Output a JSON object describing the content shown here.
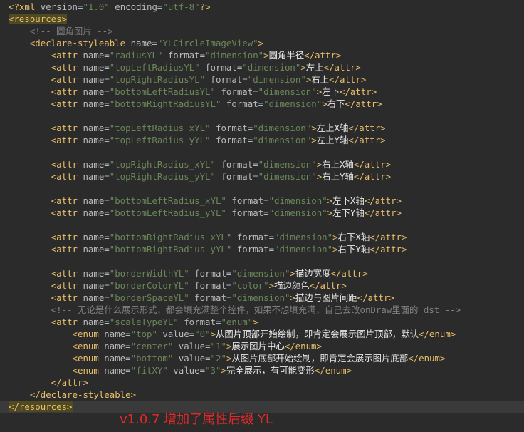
{
  "editor": {
    "lines": [
      {
        "indent": "",
        "tokens": [
          [
            "prolog",
            "<?xml "
          ],
          [
            "attr",
            "version"
          ],
          [
            "plain",
            "="
          ],
          [
            "val",
            "\"1.0\""
          ],
          [
            "plain",
            " "
          ],
          [
            "attr",
            "encoding"
          ],
          [
            "plain",
            "="
          ],
          [
            "val",
            "\"utf-8\""
          ],
          [
            "prolog",
            "?>"
          ]
        ]
      },
      {
        "indent": "",
        "mark": true,
        "tokens": [
          [
            "tag",
            "<resources>"
          ]
        ]
      },
      {
        "indent": "    ",
        "tokens": [
          [
            "comment",
            "<!-- 圆角图片 -->"
          ]
        ]
      },
      {
        "indent": "    ",
        "tokens": [
          [
            "tag",
            "<declare-styleable "
          ],
          [
            "attr",
            "name"
          ],
          [
            "plain",
            "="
          ],
          [
            "val",
            "\"YLCircleImageView\""
          ],
          [
            "tag",
            ">"
          ]
        ]
      },
      {
        "indent": "        ",
        "tokens": [
          [
            "tag",
            "<attr "
          ],
          [
            "attr",
            "name"
          ],
          [
            "plain",
            "="
          ],
          [
            "val",
            "\"radiusYL\""
          ],
          [
            "plain",
            " "
          ],
          [
            "attr",
            "format"
          ],
          [
            "plain",
            "="
          ],
          [
            "val",
            "\"dimension\""
          ],
          [
            "tag",
            ">"
          ],
          [
            "text",
            "圆角半径"
          ],
          [
            "tag",
            "</attr>"
          ]
        ]
      },
      {
        "indent": "        ",
        "tokens": [
          [
            "tag",
            "<attr "
          ],
          [
            "attr",
            "name"
          ],
          [
            "plain",
            "="
          ],
          [
            "val",
            "\"topLeftRadiusYL\""
          ],
          [
            "plain",
            " "
          ],
          [
            "attr",
            "format"
          ],
          [
            "plain",
            "="
          ],
          [
            "val",
            "\"dimension\""
          ],
          [
            "tag",
            ">"
          ],
          [
            "text",
            "左上"
          ],
          [
            "tag",
            "</attr>"
          ]
        ]
      },
      {
        "indent": "        ",
        "tokens": [
          [
            "tag",
            "<attr "
          ],
          [
            "attr",
            "name"
          ],
          [
            "plain",
            "="
          ],
          [
            "val",
            "\"topRightRadiusYL\""
          ],
          [
            "plain",
            " "
          ],
          [
            "attr",
            "format"
          ],
          [
            "plain",
            "="
          ],
          [
            "val",
            "\"dimension\""
          ],
          [
            "tag",
            ">"
          ],
          [
            "text",
            "右上"
          ],
          [
            "tag",
            "</attr>"
          ]
        ]
      },
      {
        "indent": "        ",
        "tokens": [
          [
            "tag",
            "<attr "
          ],
          [
            "attr",
            "name"
          ],
          [
            "plain",
            "="
          ],
          [
            "val",
            "\"bottomLeftRadiusYL\""
          ],
          [
            "plain",
            " "
          ],
          [
            "attr",
            "format"
          ],
          [
            "plain",
            "="
          ],
          [
            "val",
            "\"dimension\""
          ],
          [
            "tag",
            ">"
          ],
          [
            "text",
            "左下"
          ],
          [
            "tag",
            "</attr>"
          ]
        ]
      },
      {
        "indent": "        ",
        "tokens": [
          [
            "tag",
            "<attr "
          ],
          [
            "attr",
            "name"
          ],
          [
            "plain",
            "="
          ],
          [
            "val",
            "\"bottomRightRadiusYL\""
          ],
          [
            "plain",
            " "
          ],
          [
            "attr",
            "format"
          ],
          [
            "plain",
            "="
          ],
          [
            "val",
            "\"dimension\""
          ],
          [
            "tag",
            ">"
          ],
          [
            "text",
            "右下"
          ],
          [
            "tag",
            "</attr>"
          ]
        ]
      },
      {
        "indent": "",
        "tokens": []
      },
      {
        "indent": "        ",
        "tokens": [
          [
            "tag",
            "<attr "
          ],
          [
            "attr",
            "name"
          ],
          [
            "plain",
            "="
          ],
          [
            "val",
            "\"topLeftRadius_xYL\""
          ],
          [
            "plain",
            " "
          ],
          [
            "attr",
            "format"
          ],
          [
            "plain",
            "="
          ],
          [
            "val",
            "\"dimension\""
          ],
          [
            "tag",
            ">"
          ],
          [
            "text",
            "左上X轴"
          ],
          [
            "tag",
            "</attr>"
          ]
        ]
      },
      {
        "indent": "        ",
        "tokens": [
          [
            "tag",
            "<attr "
          ],
          [
            "attr",
            "name"
          ],
          [
            "plain",
            "="
          ],
          [
            "val",
            "\"topLeftRadius_yYL\""
          ],
          [
            "plain",
            " "
          ],
          [
            "attr",
            "format"
          ],
          [
            "plain",
            "="
          ],
          [
            "val",
            "\"dimension\""
          ],
          [
            "tag",
            ">"
          ],
          [
            "text",
            "左上Y轴"
          ],
          [
            "tag",
            "</attr>"
          ]
        ]
      },
      {
        "indent": "",
        "tokens": []
      },
      {
        "indent": "        ",
        "tokens": [
          [
            "tag",
            "<attr "
          ],
          [
            "attr",
            "name"
          ],
          [
            "plain",
            "="
          ],
          [
            "val",
            "\"topRightRadius_xYL\""
          ],
          [
            "plain",
            " "
          ],
          [
            "attr",
            "format"
          ],
          [
            "plain",
            "="
          ],
          [
            "val",
            "\"dimension\""
          ],
          [
            "tag",
            ">"
          ],
          [
            "text",
            "右上X轴"
          ],
          [
            "tag",
            "</attr>"
          ]
        ]
      },
      {
        "indent": "        ",
        "tokens": [
          [
            "tag",
            "<attr "
          ],
          [
            "attr",
            "name"
          ],
          [
            "plain",
            "="
          ],
          [
            "val",
            "\"topRightRadius_yYL\""
          ],
          [
            "plain",
            " "
          ],
          [
            "attr",
            "format"
          ],
          [
            "plain",
            "="
          ],
          [
            "val",
            "\"dimension\""
          ],
          [
            "tag",
            ">"
          ],
          [
            "text",
            "右上Y轴"
          ],
          [
            "tag",
            "</attr>"
          ]
        ]
      },
      {
        "indent": "",
        "tokens": []
      },
      {
        "indent": "        ",
        "tokens": [
          [
            "tag",
            "<attr "
          ],
          [
            "attr",
            "name"
          ],
          [
            "plain",
            "="
          ],
          [
            "val",
            "\"bottomLeftRadius_xYL\""
          ],
          [
            "plain",
            " "
          ],
          [
            "attr",
            "format"
          ],
          [
            "plain",
            "="
          ],
          [
            "val",
            "\"dimension\""
          ],
          [
            "tag",
            ">"
          ],
          [
            "text",
            "左下X轴"
          ],
          [
            "tag",
            "</attr>"
          ]
        ]
      },
      {
        "indent": "        ",
        "tokens": [
          [
            "tag",
            "<attr "
          ],
          [
            "attr",
            "name"
          ],
          [
            "plain",
            "="
          ],
          [
            "val",
            "\"bottomLeftRadius_yYL\""
          ],
          [
            "plain",
            " "
          ],
          [
            "attr",
            "format"
          ],
          [
            "plain",
            "="
          ],
          [
            "val",
            "\"dimension\""
          ],
          [
            "tag",
            ">"
          ],
          [
            "text",
            "左下Y轴"
          ],
          [
            "tag",
            "</attr>"
          ]
        ]
      },
      {
        "indent": "",
        "tokens": []
      },
      {
        "indent": "        ",
        "tokens": [
          [
            "tag",
            "<attr "
          ],
          [
            "attr",
            "name"
          ],
          [
            "plain",
            "="
          ],
          [
            "val",
            "\"bottomRightRadius_xYL\""
          ],
          [
            "plain",
            " "
          ],
          [
            "attr",
            "format"
          ],
          [
            "plain",
            "="
          ],
          [
            "val",
            "\"dimension\""
          ],
          [
            "tag",
            ">"
          ],
          [
            "text",
            "右下X轴"
          ],
          [
            "tag",
            "</attr>"
          ]
        ]
      },
      {
        "indent": "        ",
        "tokens": [
          [
            "tag",
            "<attr "
          ],
          [
            "attr",
            "name"
          ],
          [
            "plain",
            "="
          ],
          [
            "val",
            "\"bottomRightRadius_yYL\""
          ],
          [
            "plain",
            " "
          ],
          [
            "attr",
            "format"
          ],
          [
            "plain",
            "="
          ],
          [
            "val",
            "\"dimension\""
          ],
          [
            "tag",
            ">"
          ],
          [
            "text",
            "右下Y轴"
          ],
          [
            "tag",
            "</attr>"
          ]
        ]
      },
      {
        "indent": "",
        "tokens": []
      },
      {
        "indent": "        ",
        "tokens": [
          [
            "tag",
            "<attr "
          ],
          [
            "attr",
            "name"
          ],
          [
            "plain",
            "="
          ],
          [
            "val",
            "\"borderWidthYL\""
          ],
          [
            "plain",
            " "
          ],
          [
            "attr",
            "format"
          ],
          [
            "plain",
            "="
          ],
          [
            "val",
            "\"dimension\""
          ],
          [
            "tag",
            ">"
          ],
          [
            "text",
            "描边宽度"
          ],
          [
            "tag",
            "</attr>"
          ]
        ]
      },
      {
        "indent": "        ",
        "tokens": [
          [
            "tag",
            "<attr "
          ],
          [
            "attr",
            "name"
          ],
          [
            "plain",
            "="
          ],
          [
            "val",
            "\"borderColorYL\""
          ],
          [
            "plain",
            " "
          ],
          [
            "attr",
            "format"
          ],
          [
            "plain",
            "="
          ],
          [
            "val",
            "\"color\""
          ],
          [
            "tag",
            ">"
          ],
          [
            "text",
            "描边颜色"
          ],
          [
            "tag",
            "</attr>"
          ]
        ]
      },
      {
        "indent": "        ",
        "tokens": [
          [
            "tag",
            "<attr "
          ],
          [
            "attr",
            "name"
          ],
          [
            "plain",
            "="
          ],
          [
            "val",
            "\"borderSpaceYL\""
          ],
          [
            "plain",
            " "
          ],
          [
            "attr",
            "format"
          ],
          [
            "plain",
            "="
          ],
          [
            "val",
            "\"dimension\""
          ],
          [
            "tag",
            ">"
          ],
          [
            "text",
            "描边与图片间距"
          ],
          [
            "tag",
            "</attr>"
          ]
        ]
      },
      {
        "indent": "        ",
        "tokens": [
          [
            "comment",
            "<!-- 无论是什么展示形式，都会填充满整个控件，如果不想填充满，自己去改onDraw里面的 dst -->"
          ]
        ]
      },
      {
        "indent": "        ",
        "tokens": [
          [
            "tag",
            "<attr "
          ],
          [
            "attr",
            "name"
          ],
          [
            "plain",
            "="
          ],
          [
            "val",
            "\"scaleTypeYL\""
          ],
          [
            "plain",
            " "
          ],
          [
            "attr",
            "format"
          ],
          [
            "plain",
            "="
          ],
          [
            "val",
            "\"enum\""
          ],
          [
            "tag",
            ">"
          ]
        ]
      },
      {
        "indent": "            ",
        "tokens": [
          [
            "tag",
            "<enum "
          ],
          [
            "attr",
            "name"
          ],
          [
            "plain",
            "="
          ],
          [
            "val",
            "\"top\""
          ],
          [
            "plain",
            " "
          ],
          [
            "attr",
            "value"
          ],
          [
            "plain",
            "="
          ],
          [
            "val",
            "\"0\""
          ],
          [
            "tag",
            ">"
          ],
          [
            "text",
            "从图片顶部开始绘制，即肯定会展示图片顶部，默认"
          ],
          [
            "tag",
            "</enum>"
          ]
        ]
      },
      {
        "indent": "            ",
        "tokens": [
          [
            "tag",
            "<enum "
          ],
          [
            "attr",
            "name"
          ],
          [
            "plain",
            "="
          ],
          [
            "val",
            "\"center\""
          ],
          [
            "plain",
            " "
          ],
          [
            "attr",
            "value"
          ],
          [
            "plain",
            "="
          ],
          [
            "val",
            "\"1\""
          ],
          [
            "tag",
            ">"
          ],
          [
            "text",
            "展示图片中心"
          ],
          [
            "tag",
            "</enum>"
          ]
        ]
      },
      {
        "indent": "            ",
        "tokens": [
          [
            "tag",
            "<enum "
          ],
          [
            "attr",
            "name"
          ],
          [
            "plain",
            "="
          ],
          [
            "val",
            "\"bottom\""
          ],
          [
            "plain",
            " "
          ],
          [
            "attr",
            "value"
          ],
          [
            "plain",
            "="
          ],
          [
            "val",
            "\"2\""
          ],
          [
            "tag",
            ">"
          ],
          [
            "text",
            "从图片底部开始绘制，即肯定会展示图片底部"
          ],
          [
            "tag",
            "</enum>"
          ]
        ]
      },
      {
        "indent": "            ",
        "tokens": [
          [
            "tag",
            "<enum "
          ],
          [
            "attr",
            "name"
          ],
          [
            "plain",
            "="
          ],
          [
            "val",
            "\"fitXY\""
          ],
          [
            "plain",
            " "
          ],
          [
            "attr",
            "value"
          ],
          [
            "plain",
            "="
          ],
          [
            "val",
            "\"3\""
          ],
          [
            "tag",
            ">"
          ],
          [
            "text",
            "完全展示，有可能变形"
          ],
          [
            "tag",
            "</enum>"
          ]
        ]
      },
      {
        "indent": "        ",
        "tokens": [
          [
            "tag",
            "</attr>"
          ]
        ]
      },
      {
        "indent": "    ",
        "tokens": [
          [
            "tag",
            "</declare-styleable>"
          ]
        ]
      },
      {
        "indent": "",
        "mark": true,
        "highlight": true,
        "tokens": [
          [
            "tag",
            "</resources>"
          ]
        ]
      }
    ]
  },
  "annotation": {
    "text": "v1.0.7 增加了属性后缀 YL",
    "color": "#e02a2a"
  },
  "colors": {
    "background": "#2b2b2b",
    "tag": "#e8bf6a",
    "attribute": "#bababa",
    "value": "#6a8759",
    "comment": "#808080",
    "text": "#e6e6e6"
  }
}
